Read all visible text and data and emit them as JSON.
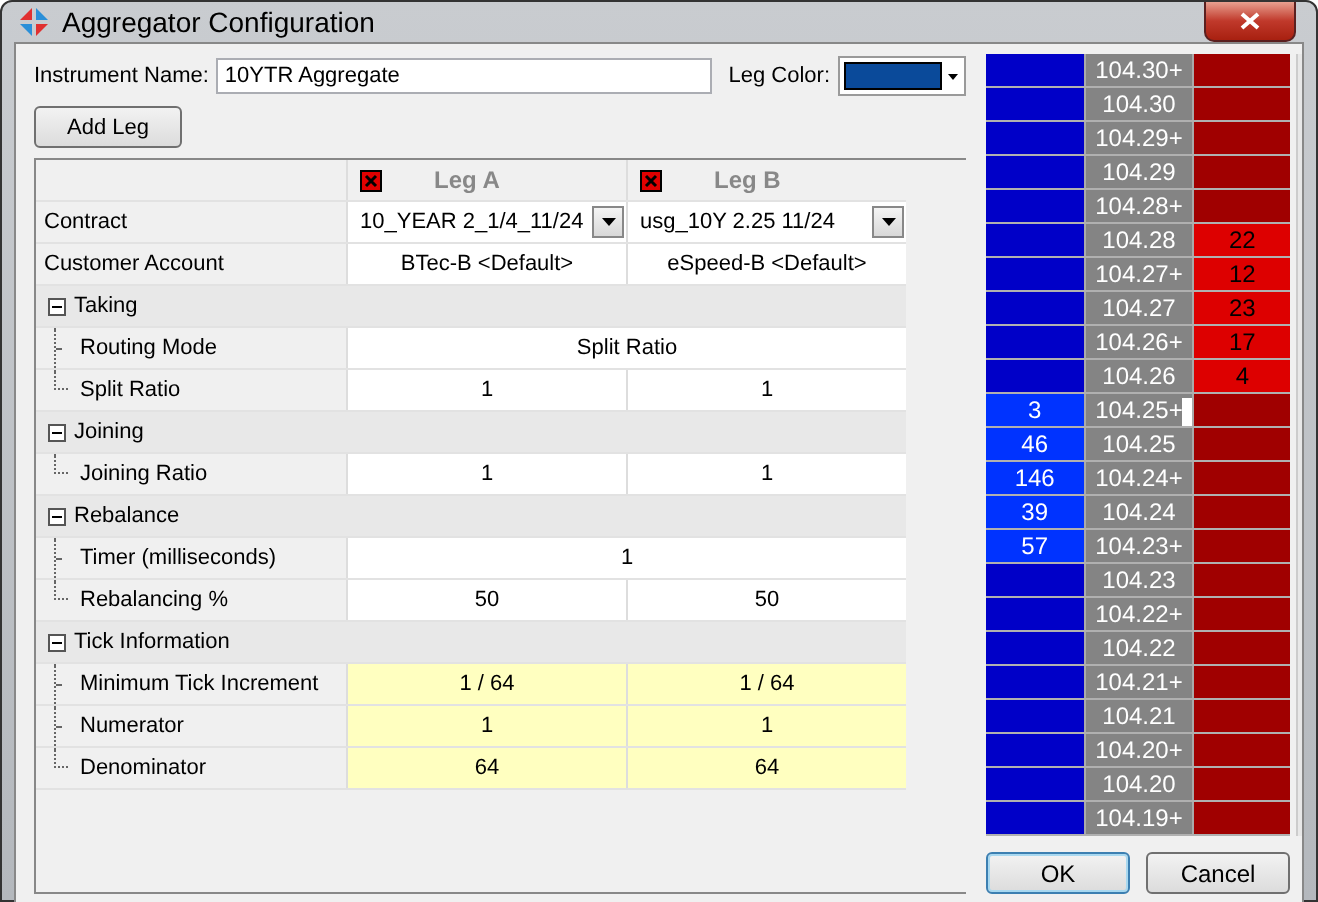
{
  "window": {
    "title": "Aggregator Configuration"
  },
  "instrument_name": {
    "label": "Instrument Name:",
    "value": "10YTR Aggregate"
  },
  "leg_color": {
    "label": "Leg Color:",
    "color": "#0a4a9a"
  },
  "add_leg_button": "Add Leg",
  "table": {
    "legs": [
      {
        "label": "Leg A"
      },
      {
        "label": "Leg B"
      }
    ],
    "rows": [
      {
        "kind": "dropdown",
        "label": "Contract",
        "values": [
          "10_YEAR 2_1/4_11/24",
          "usg_10Y 2.25 11/24"
        ]
      },
      {
        "kind": "plain",
        "label": "Customer Account",
        "values": [
          "BTec-B <Default>",
          "eSpeed-B <Default>"
        ]
      },
      {
        "kind": "group",
        "label": "Taking",
        "expanded": true,
        "children": [
          {
            "label": "Routing Mode",
            "values": [
              "Split Ratio"
            ],
            "readonly": false
          },
          {
            "label": "Split Ratio",
            "values": [
              "1",
              "1"
            ],
            "readonly": false
          }
        ]
      },
      {
        "kind": "group",
        "label": "Joining",
        "expanded": true,
        "children": [
          {
            "label": "Joining Ratio",
            "values": [
              "1",
              "1"
            ],
            "readonly": false
          }
        ]
      },
      {
        "kind": "group",
        "label": "Rebalance",
        "expanded": true,
        "children": [
          {
            "label": "Timer (milliseconds)",
            "values": [
              "1"
            ],
            "readonly": false
          },
          {
            "label": "Rebalancing %",
            "values": [
              "50",
              "50"
            ],
            "readonly": false
          }
        ]
      },
      {
        "kind": "group",
        "label": "Tick Information",
        "expanded": true,
        "children": [
          {
            "label": "Minimum Tick Increment",
            "values": [
              "1 / 64",
              "1 / 64"
            ],
            "readonly": true
          },
          {
            "label": "Numerator",
            "values": [
              "1",
              "1"
            ],
            "readonly": true
          },
          {
            "label": "Denominator",
            "values": [
              "64",
              "64"
            ],
            "readonly": true
          }
        ]
      }
    ]
  },
  "ladder": [
    {
      "price": "104.30+",
      "marker": false
    },
    {
      "price": "104.30",
      "marker": false
    },
    {
      "price": "104.29+",
      "marker": false
    },
    {
      "price": "104.29",
      "marker": false
    },
    {
      "price": "104.28+",
      "marker": false
    },
    {
      "price": "104.28",
      "ask": "22",
      "marker": false
    },
    {
      "price": "104.27+",
      "ask": "12",
      "marker": false
    },
    {
      "price": "104.27",
      "ask": "23",
      "marker": false
    },
    {
      "price": "104.26+",
      "ask": "17",
      "marker": false
    },
    {
      "price": "104.26",
      "ask": "4",
      "marker": false
    },
    {
      "bid": "3",
      "price": "104.25+",
      "marker": true
    },
    {
      "bid": "46",
      "price": "104.25",
      "marker": false
    },
    {
      "bid": "146",
      "price": "104.24+",
      "marker": false
    },
    {
      "bid": "39",
      "price": "104.24",
      "marker": false
    },
    {
      "bid": "57",
      "price": "104.23+",
      "marker": false
    },
    {
      "price": "104.23",
      "marker": false
    },
    {
      "price": "104.22+",
      "marker": false
    },
    {
      "price": "104.22",
      "marker": false
    },
    {
      "price": "104.21+",
      "marker": false
    },
    {
      "price": "104.21",
      "marker": false
    },
    {
      "price": "104.20+",
      "marker": false
    },
    {
      "price": "104.20",
      "marker": false
    },
    {
      "price": "104.19+",
      "marker": false
    }
  ],
  "buttons": [
    {
      "label": "OK",
      "selected": true
    },
    {
      "label": "Cancel",
      "selected": false
    }
  ]
}
